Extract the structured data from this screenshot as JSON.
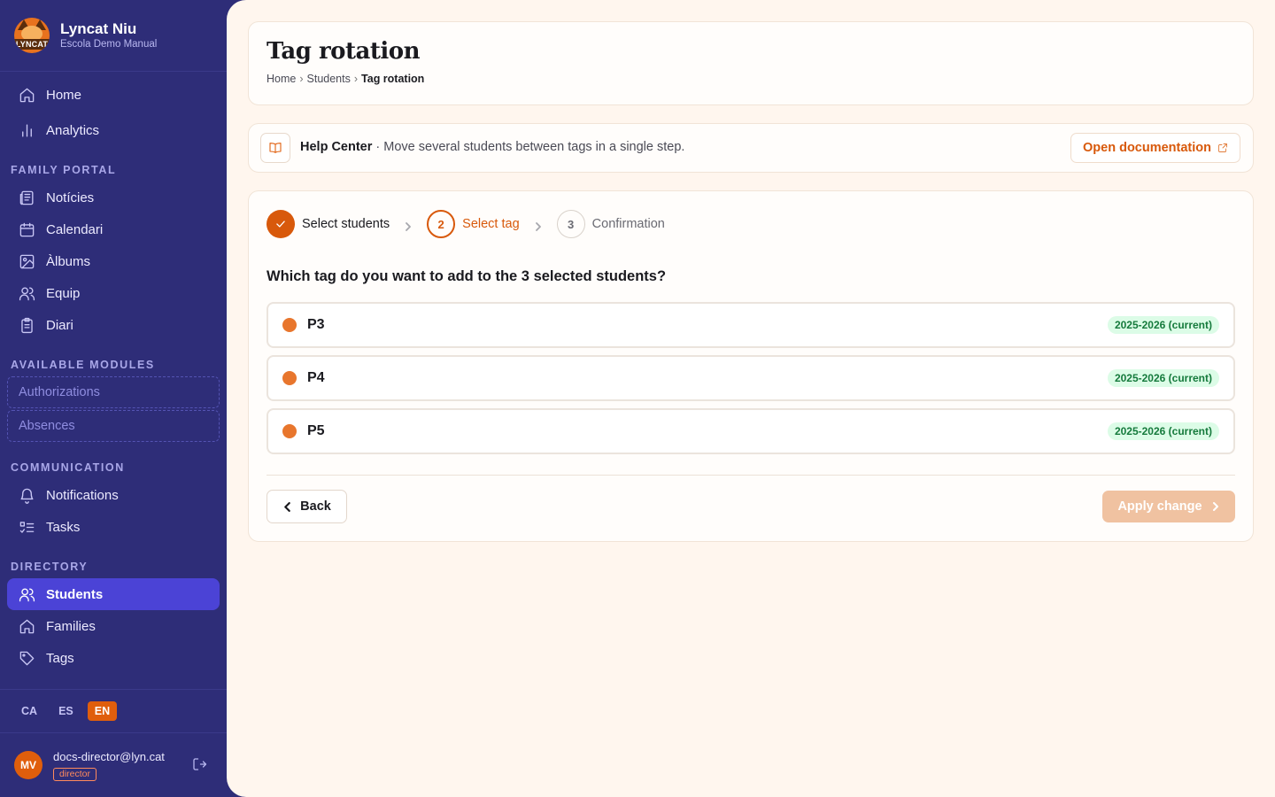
{
  "brand": {
    "name": "Lyncat Niu",
    "subtitle": "Escola Demo Manual",
    "logo_text": "LYNCAT"
  },
  "sidebar": {
    "top_items": [
      {
        "label": "Home",
        "icon": "home-icon"
      },
      {
        "label": "Analytics",
        "icon": "bar-chart-icon"
      }
    ],
    "family_portal": {
      "heading": "FAMILY PORTAL",
      "items": [
        {
          "label": "Notícies",
          "icon": "newspaper-icon"
        },
        {
          "label": "Calendari",
          "icon": "calendar-icon"
        },
        {
          "label": "Àlbums",
          "icon": "image-icon"
        },
        {
          "label": "Equip",
          "icon": "users-icon"
        },
        {
          "label": "Diari",
          "icon": "clipboard-icon"
        }
      ]
    },
    "available_modules": {
      "heading": "AVAILABLE MODULES",
      "items": [
        {
          "label": "Authorizations"
        },
        {
          "label": "Absences"
        }
      ]
    },
    "communication": {
      "heading": "COMMUNICATION",
      "items": [
        {
          "label": "Notifications",
          "icon": "bell-icon"
        },
        {
          "label": "Tasks",
          "icon": "task-list-icon"
        }
      ]
    },
    "directory": {
      "heading": "DIRECTORY",
      "items": [
        {
          "label": "Students",
          "icon": "users-icon",
          "active": true
        },
        {
          "label": "Families",
          "icon": "home-icon"
        },
        {
          "label": "Tags",
          "icon": "tag-icon"
        }
      ]
    }
  },
  "languages": {
    "items": [
      "CA",
      "ES",
      "EN"
    ],
    "active": "EN"
  },
  "user": {
    "initials": "MV",
    "email": "docs-director@lyn.cat",
    "role": "director"
  },
  "page": {
    "title": "Tag rotation",
    "breadcrumb": {
      "home": "Home",
      "students": "Students",
      "current": "Tag rotation",
      "separator": "›"
    }
  },
  "help": {
    "title": "Help Center",
    "text": " · Move several students between tags in a single step.",
    "doc_button": "Open documentation"
  },
  "wizard": {
    "steps": [
      {
        "number": "1",
        "label": "Select students",
        "state": "done"
      },
      {
        "number": "2",
        "label": "Select tag",
        "state": "current"
      },
      {
        "number": "3",
        "label": "Confirmation",
        "state": "todo"
      }
    ],
    "question": "Which tag do you want to add to the 3 selected students?",
    "tags": [
      {
        "name": "P3",
        "year": "2025-2026 (current)",
        "color": "#e8762d"
      },
      {
        "name": "P4",
        "year": "2025-2026 (current)",
        "color": "#e8762d"
      },
      {
        "name": "P5",
        "year": "2025-2026 (current)",
        "color": "#e8762d"
      }
    ],
    "back_label": "Back",
    "apply_label": "Apply change"
  },
  "colors": {
    "accent": "#d8590b",
    "sidebar": "#2e2d78",
    "active_nav": "#4b43d6",
    "badge_bg": "#dcfce7",
    "badge_text": "#157a3c"
  }
}
